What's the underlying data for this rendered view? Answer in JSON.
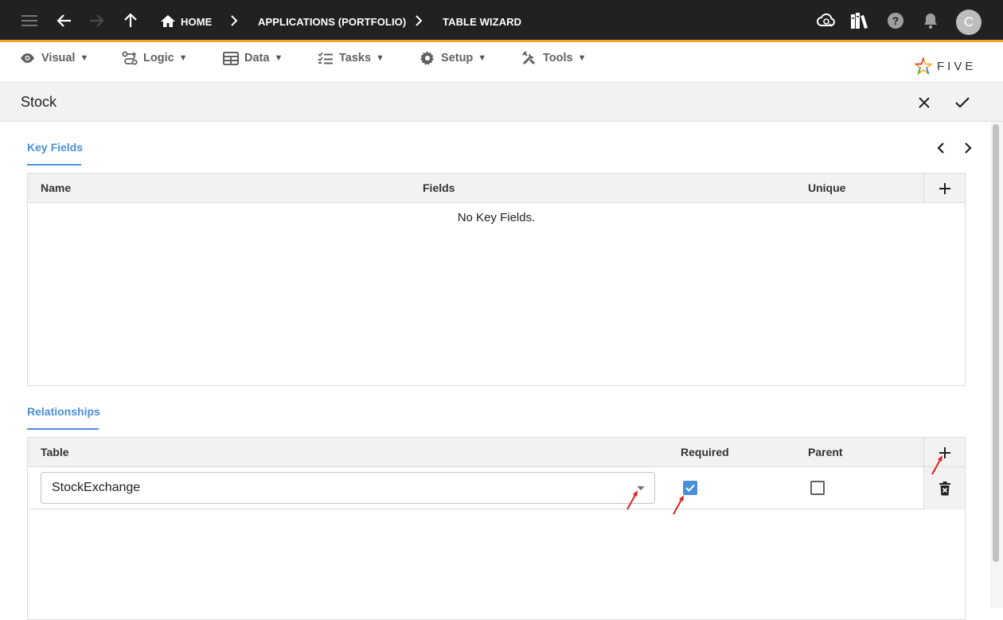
{
  "topbar": {
    "breadcrumbs": [
      "HOME",
      "APPLICATIONS (PORTFOLIO)",
      "TABLE WIZARD"
    ],
    "avatar_initial": "C"
  },
  "menu": [
    {
      "label": "Visual",
      "icon": "eye-icon"
    },
    {
      "label": "Logic",
      "icon": "logic-icon"
    },
    {
      "label": "Data",
      "icon": "table-icon"
    },
    {
      "label": "Tasks",
      "icon": "tasks-icon"
    },
    {
      "label": "Setup",
      "icon": "gear-icon"
    },
    {
      "label": "Tools",
      "icon": "tools-icon"
    }
  ],
  "menu_caret": "▼",
  "logo_text": "FIVE",
  "form": {
    "title": "Stock"
  },
  "key_fields": {
    "tab_label": "Key Fields",
    "columns": [
      "Name",
      "Fields",
      "Unique"
    ],
    "empty_message": "No Key Fields."
  },
  "relationships": {
    "tab_label": "Relationships",
    "columns": [
      "Table",
      "Required",
      "Parent"
    ],
    "rows": [
      {
        "table": "StockExchange",
        "required": true,
        "parent": false
      }
    ]
  },
  "colors": {
    "topbar_bg": "#212121",
    "accent_orange": "#f5a623",
    "accent_blue": "#4a90d9",
    "annotation_red": "#e02020"
  }
}
